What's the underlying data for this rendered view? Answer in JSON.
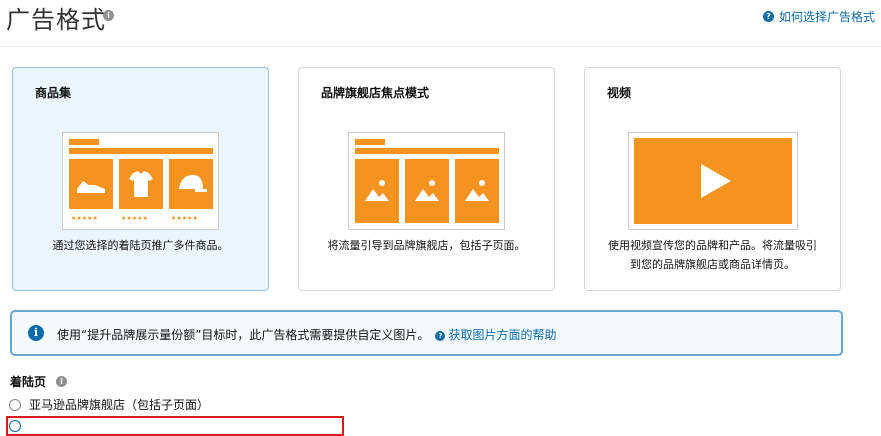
{
  "header": {
    "title": "广告格式",
    "help_link": "如何选择广告格式"
  },
  "formats": [
    {
      "title": "商品集",
      "desc": "通过您选择的着陆页推广多件商品。",
      "selected": true,
      "stars": [
        "★★★★★",
        "★★★★★",
        "★★★★★"
      ]
    },
    {
      "title": "品牌旗舰店焦点模式",
      "desc": "将流量引导到品牌旗舰店，包括子页面。",
      "selected": false
    },
    {
      "title": "视频",
      "desc_lines": [
        "使用视频宣传您的品牌和产品。将流量吸引",
        "到您的品牌旗舰店或商品详情页。"
      ],
      "selected": false
    }
  ],
  "notice": {
    "text": "使用“提升品牌展示量份额”目标时，此广告格式需要提供自定义图片。",
    "link": "获取图片方面的帮助"
  },
  "landing": {
    "label": "着陆页",
    "options": [
      "亚马逊品牌旗舰店（包括子页面）"
    ]
  },
  "colors": {
    "accent_orange": "#f49320",
    "link_blue": "#0b6aa8",
    "selected_bg": "#ebf5fd",
    "highlight_red": "#d91d1d"
  }
}
